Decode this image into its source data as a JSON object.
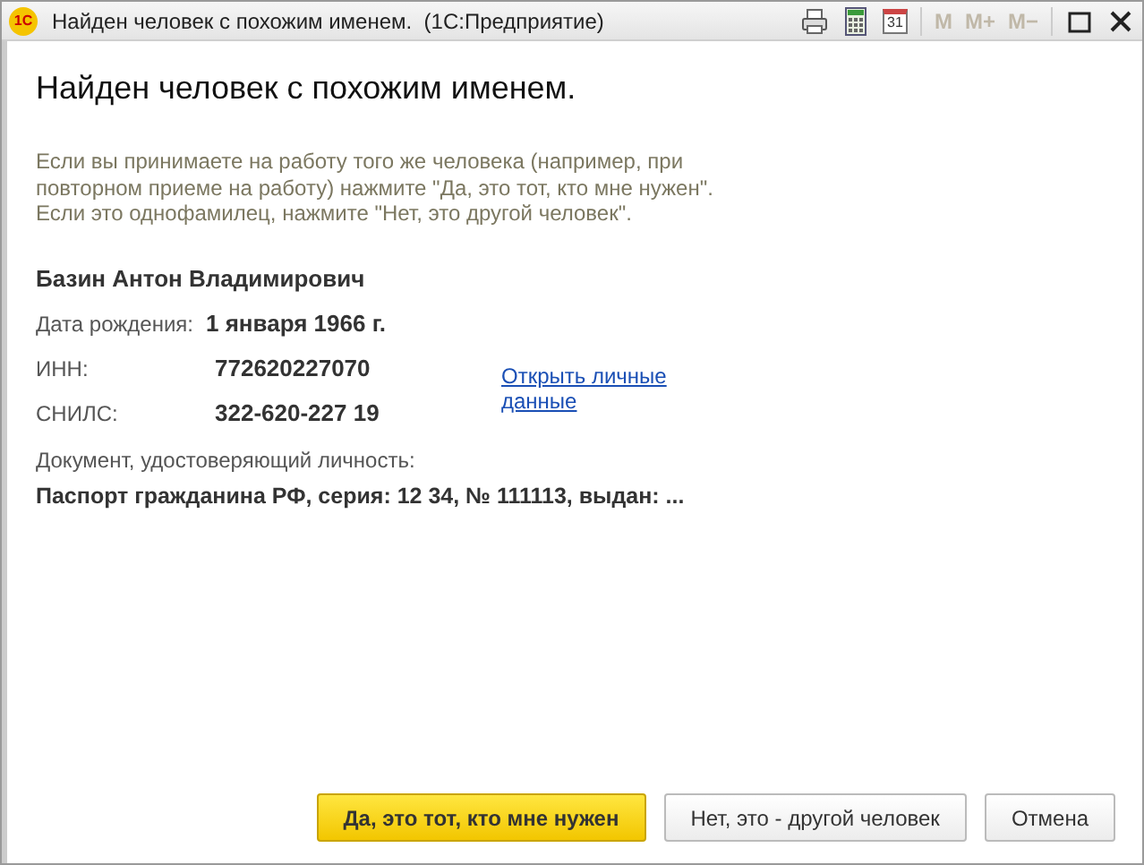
{
  "window": {
    "title": "Найден человек с похожим именем.  (1С:Предприятие)",
    "logo": "1С",
    "toolbar": [
      "31",
      "M",
      "M+",
      "M−"
    ]
  },
  "heading": "Найден человек с похожим именем.",
  "hint": [
    "Если вы принимаете на работу того же человека (например, при повторном приеме на работу) нажмите \"Да, это тот, кто мне нужен\".",
    "Если это однофамилец, нажмите \"Нет, это другой человек\"."
  ],
  "person": {
    "name": "Базин Антон Владимирович",
    "fields": [
      {
        "label": "Дата рождения:",
        "value": "1 января 1966 г."
      },
      {
        "label": "ИНН:",
        "value": "772620227070"
      },
      {
        "label": "СНИЛС:",
        "value": "322-620-227 19"
      }
    ],
    "link": "Открыть личные данные",
    "document_label": "Документ, удостоверяющий личность:",
    "document": "Паспорт гражданина РФ, серия: 12 34, № 111113, выдан: ..."
  },
  "buttons": [
    {
      "label": "Да, это тот, кто мне нужен",
      "default": true
    },
    {
      "label": "Нет, это - другой человек",
      "default": false
    },
    {
      "label": "Отмена",
      "default": false
    }
  ]
}
